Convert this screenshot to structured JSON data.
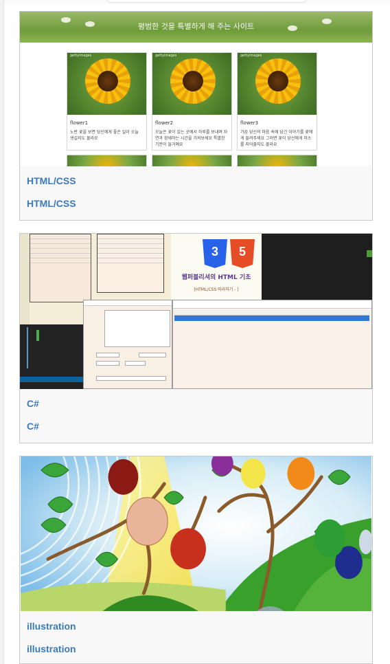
{
  "cards": [
    {
      "preview": {
        "site_title": "평범한 것을 특별하게 해 주는 사이트",
        "flowers": [
          {
            "title": "flower1",
            "desc": "노란 꽃을 보면 당신에게 좋은 일이 오늘 생길지도 몰라요"
          },
          {
            "title": "flower2",
            "desc": "오늘은 꽃이 있는 곳에서 하루를 보내며 자연과 함께하는 시간을 가져보세요 특별한 기분이 들거예요"
          },
          {
            "title": "flower3",
            "desc": "가끔 당신의 마음 속에 담긴 이야기를 꽃에게 들려주세요 그러면 꽃이 당신에게 미소를 지어줄지도 몰라요"
          }
        ],
        "photo_tag": "gettyimages"
      },
      "links": [
        "HTML/CSS",
        "HTML/CSS"
      ]
    },
    {
      "preview": {
        "book_title": "웹퍼블리셔의 HTML 기초",
        "book_subtitle": "[HTML/CSS 따라하기 - ]",
        "logo_css": "3",
        "logo_html": "5",
        "logo_css_label": "CSS",
        "logo_html_label": "HTML"
      },
      "links": [
        "C#",
        "C#"
      ]
    },
    {
      "links": [
        "illustration",
        "illustration"
      ]
    }
  ],
  "colors": {
    "link": "#3a7ab8",
    "card_bg": "#f8f8f8",
    "card_border": "#c9c9c9"
  }
}
